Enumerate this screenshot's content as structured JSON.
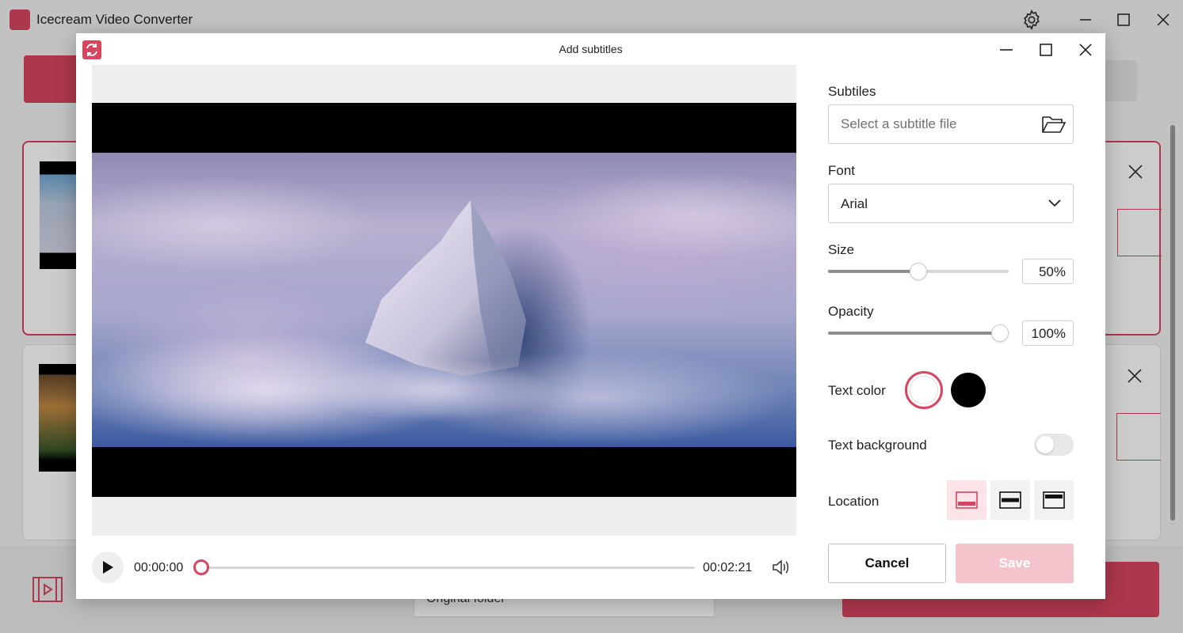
{
  "app": {
    "title": "Icecream Video Converter",
    "output_folder_label": "Original folder",
    "accent_color": "#d9455f"
  },
  "dialog": {
    "title": "Add subtitles",
    "icons": [
      "app-logo-icon",
      "minimize-icon",
      "maximize-icon",
      "close-icon"
    ]
  },
  "player": {
    "current_time": "00:00:00",
    "total_time": "00:02:21",
    "progress": 0
  },
  "settings": {
    "subtitles": {
      "label": "Subtiles",
      "placeholder": "Select a subtitle file"
    },
    "font": {
      "label": "Font",
      "value": "Arial"
    },
    "size": {
      "label": "Size",
      "value_text": "50%",
      "value": 0.5
    },
    "opacity": {
      "label": "Opacity",
      "value_text": "100%",
      "value": 1.0
    },
    "text_color": {
      "label": "Text color",
      "options": [
        "#ffffff",
        "#000000"
      ],
      "selected": "#ffffff"
    },
    "text_background": {
      "label": "Text background",
      "enabled": false
    },
    "location": {
      "label": "Location",
      "options": [
        "bottom",
        "middle",
        "top"
      ],
      "selected": "bottom"
    }
  },
  "buttons": {
    "cancel": "Cancel",
    "save": "Save"
  }
}
